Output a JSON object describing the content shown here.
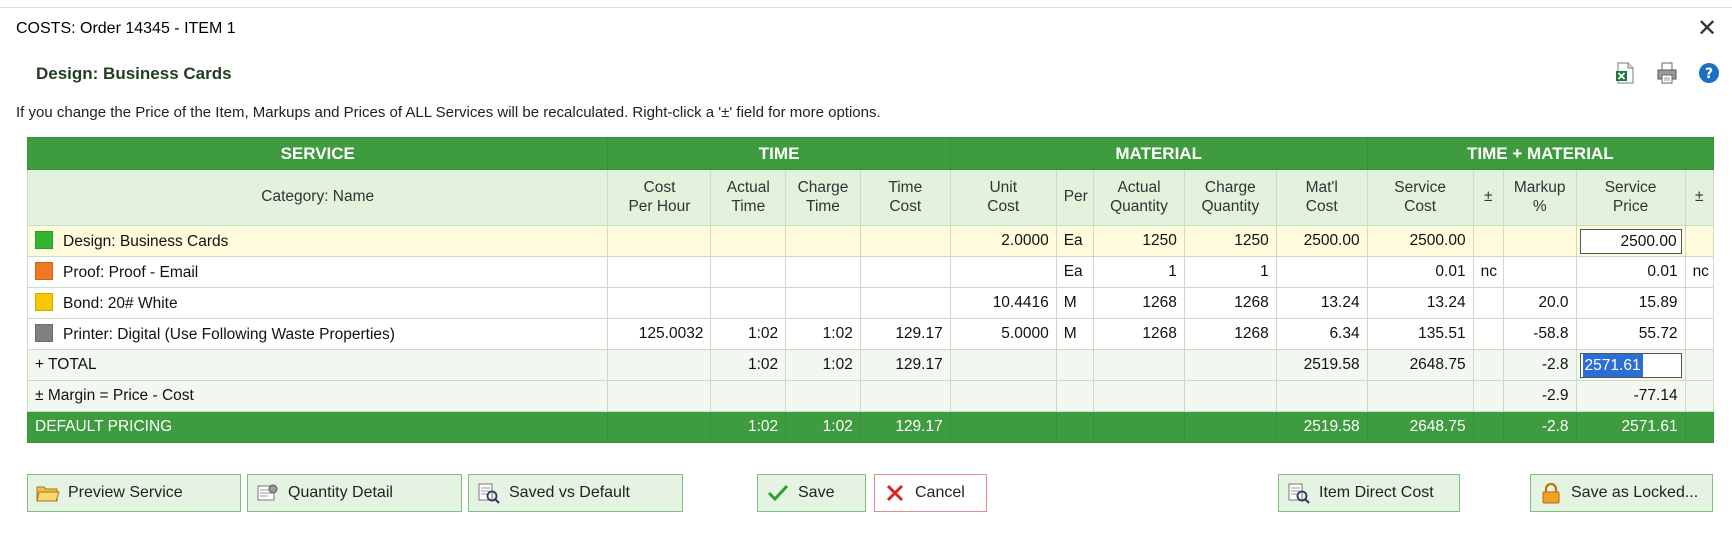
{
  "window": {
    "title": "COSTS: Order 14345 - ITEM 1",
    "close_glyph": "✕"
  },
  "header": {
    "heading": "Design: Business Cards",
    "icons": [
      "excel-export-icon",
      "print-icon",
      "help-icon"
    ]
  },
  "info_text": "If you change the Price of the Item, Markups and Prices of ALL Services will be recalculated. Right-click a '±' field for more options.",
  "table": {
    "groups": {
      "service": "SERVICE",
      "time": "TIME",
      "material": "MATERIAL",
      "time_material": "TIME + MATERIAL"
    },
    "subheaders": {
      "category_name": "Category: Name",
      "cost_per_hour": [
        "Cost",
        "Per Hour"
      ],
      "actual_time": [
        "Actual",
        "Time"
      ],
      "charge_time": [
        "Charge",
        "Time"
      ],
      "time_cost": [
        "Time",
        "Cost"
      ],
      "unit_cost": [
        "Unit",
        "Cost"
      ],
      "per": "Per",
      "actual_qty": [
        "Actual",
        "Quantity"
      ],
      "charge_qty": [
        "Charge",
        "Quantity"
      ],
      "mat_cost": [
        "Mat'l",
        "Cost"
      ],
      "service_cost": [
        "Service",
        "Cost"
      ],
      "pm1": "±",
      "markup": [
        "Markup",
        "%"
      ],
      "service_price": [
        "Service",
        "Price"
      ],
      "pm2": "±"
    },
    "rows": [
      {
        "color": "#2fb52f",
        "name": "Design: Business Cards",
        "cost_per_hour": "",
        "actual_time": "",
        "charge_time": "",
        "time_cost": "",
        "unit_cost": "2.0000",
        "per": "Ea",
        "actual_qty": "1250",
        "charge_qty": "1250",
        "mat_cost": "2500.00",
        "service_cost": "2500.00",
        "pm1": "",
        "markup": "",
        "service_price": "2500.00",
        "pm2": ""
      },
      {
        "color": "#f07820",
        "name": "Proof: Proof - Email",
        "cost_per_hour": "",
        "actual_time": "",
        "charge_time": "",
        "time_cost": "",
        "unit_cost": "",
        "per": "Ea",
        "actual_qty": "1",
        "charge_qty": "1",
        "mat_cost": "",
        "service_cost": "0.01",
        "pm1": "nc",
        "markup": "",
        "service_price": "0.01",
        "pm2": "nc"
      },
      {
        "color": "#f5c800",
        "name": "Bond: 20# White",
        "cost_per_hour": "",
        "actual_time": "",
        "charge_time": "",
        "time_cost": "",
        "unit_cost": "10.4416",
        "per": "M",
        "actual_qty": "1268",
        "charge_qty": "1268",
        "mat_cost": "13.24",
        "service_cost": "13.24",
        "pm1": "",
        "markup": "20.0",
        "service_price": "15.89",
        "pm2": ""
      },
      {
        "color": "#808080",
        "name": "Printer: Digital (Use Following Waste Properties)",
        "cost_per_hour": "125.0032",
        "actual_time": "1:02",
        "charge_time": "1:02",
        "time_cost": "129.17",
        "unit_cost": "5.0000",
        "per": "M",
        "actual_qty": "1268",
        "charge_qty": "1268",
        "mat_cost": "6.34",
        "service_cost": "135.51",
        "pm1": "",
        "markup": "-58.8",
        "service_price": "55.72",
        "pm2": ""
      }
    ],
    "total": {
      "label": "+ TOTAL",
      "actual_time": "1:02",
      "charge_time": "1:02",
      "time_cost": "129.17",
      "mat_cost": "2519.58",
      "service_cost": "2648.75",
      "markup": "-2.8",
      "service_price": "2571.61"
    },
    "margin": {
      "label": "± Margin = Price - Cost",
      "markup": "-2.9",
      "service_price": "-77.14"
    },
    "default_pricing": {
      "label": "DEFAULT PRICING",
      "actual_time": "1:02",
      "charge_time": "1:02",
      "time_cost": "129.17",
      "mat_cost": "2519.58",
      "service_cost": "2648.75",
      "markup": "-2.8",
      "service_price": "2571.61"
    }
  },
  "buttons": {
    "preview_service": "Preview Service",
    "quantity_detail": "Quantity Detail",
    "saved_vs_default": "Saved vs Default",
    "save": "Save",
    "cancel": "Cancel",
    "item_direct_cost": "Item Direct Cost",
    "save_as_locked": "Save as Locked..."
  },
  "colors": {
    "accent_green": "#3e9b3e",
    "subheader_green": "#e2f2dd",
    "highlight_row": "#fffbdc",
    "selection_blue": "#2a6fd6",
    "heading_text": "#1f3f1f"
  }
}
